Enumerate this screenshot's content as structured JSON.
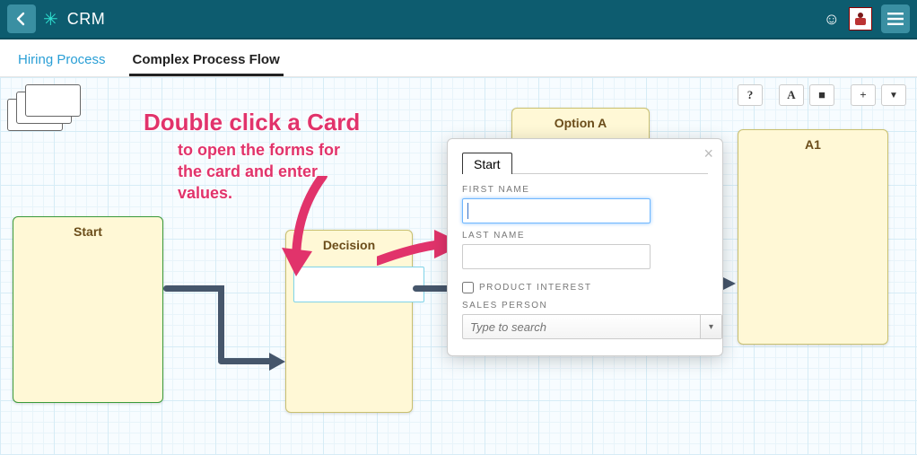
{
  "header": {
    "title": "CRM"
  },
  "tabs": {
    "inactive": "Hiring Process",
    "active": "Complex Process Flow"
  },
  "toolbar": {
    "help": "?",
    "text": "A",
    "fill": "■",
    "add": "+",
    "filter": "▼"
  },
  "cards": {
    "start": "Start",
    "decision": "Decision",
    "optionA": "Option A",
    "a1": "A1"
  },
  "annotation": {
    "line1": "Double click a Card",
    "line2": "to open the forms for",
    "line3": "the card and enter",
    "line4": "values."
  },
  "popup": {
    "tab": "Start",
    "first_name_label": "FIRST NAME",
    "first_name_value": "",
    "last_name_label": "LAST NAME",
    "last_name_value": "",
    "product_interest_label": "PRODUCT INTEREST",
    "product_interest_checked": false,
    "sales_person_label": "SALES PERSON",
    "sales_person_placeholder": "Type to search"
  }
}
